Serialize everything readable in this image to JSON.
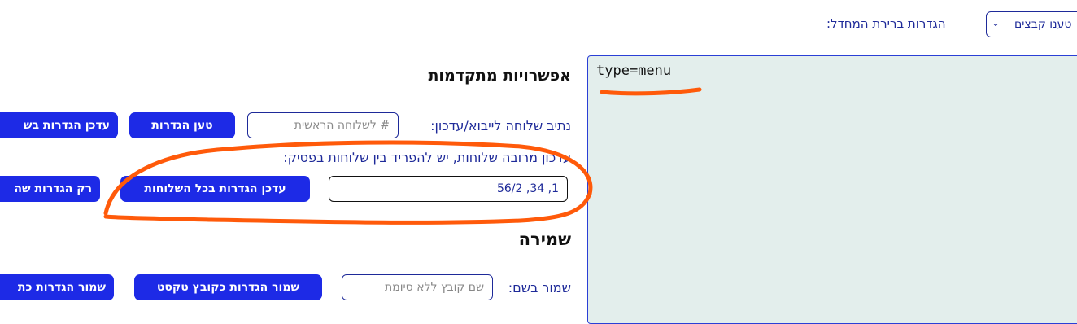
{
  "top": {
    "label": "הגדרות ברירת המחדל:",
    "select_value": "טענו קבצים"
  },
  "editor": {
    "content": "type=menu"
  },
  "advanced": {
    "heading": "אפשרויות מתקדמות",
    "path_label": "נתיב שלוחה לייבוא/עדכון:",
    "path_placeholder": "# לשלוחה הראשית",
    "load_button": "טען הגדרות",
    "update_button": "עדכן הגדרות בש",
    "multi_label": "עדכון מרובה שלוחות, יש להפריד בין שלוחות בפסיק:",
    "multi_value": "1, 34, 56/2",
    "update_all_button": "עדכן הגדרות בכל השלוחות",
    "only_settings_button": "רק הגדרות שה"
  },
  "save": {
    "heading": "שמירה",
    "save_as_label": "שמור בשם:",
    "filename_placeholder": "שם קובץ ללא סיומת",
    "save_text_button": "שמור הגדרות כקובץ טקסט",
    "save_other_button": "שמור הגדרות כת"
  },
  "annotation_color": "#ff5a0a"
}
